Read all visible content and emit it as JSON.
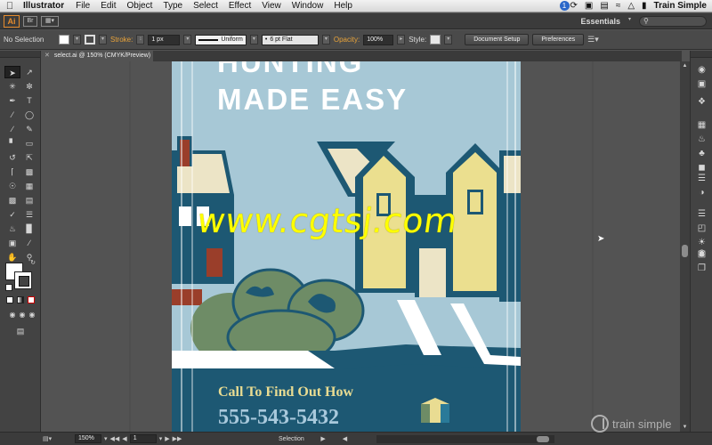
{
  "menubar": {
    "apple": "",
    "app_name": "Illustrator",
    "items": [
      "File",
      "Edit",
      "Object",
      "Type",
      "Select",
      "Effect",
      "View",
      "Window",
      "Help"
    ],
    "notification_count": "1",
    "user_name": "Train Simple"
  },
  "appbar": {
    "logo": "Ai",
    "bridge": "Br",
    "workspace": "Essentials"
  },
  "control": {
    "selection": "No Selection",
    "stroke_label": "Stroke:",
    "stroke_weight": "1 px",
    "stroke_profile": "Uniform",
    "brush": "6 pt Flat",
    "opacity_label": "Opacity:",
    "opacity_value": "100%",
    "style_label": "Style:",
    "document_setup": "Document Setup",
    "preferences": "Preferences"
  },
  "tab": {
    "title": "select.ai @ 150% (CMYK/Preview)"
  },
  "artwork": {
    "headline_line1": "HUNTING",
    "headline_line2": "MADE EASY",
    "cta": "Call To Find Out How",
    "phone": "555-543-5432",
    "colors": {
      "sky": "#a7c8d6",
      "navy": "#1d5873",
      "cream": "#ece4c6",
      "yellow": "#ebdf8f",
      "green": "#6e8c66",
      "brick": "#9a3e2a",
      "gold_text": "#e9dc92",
      "light_blue_text": "#a9c9dc"
    }
  },
  "status": {
    "zoom": "150%",
    "artboard": "1",
    "mode": "Selection"
  },
  "overlays": {
    "watermark": "www.cgtsj.com",
    "brand": "train simple"
  }
}
